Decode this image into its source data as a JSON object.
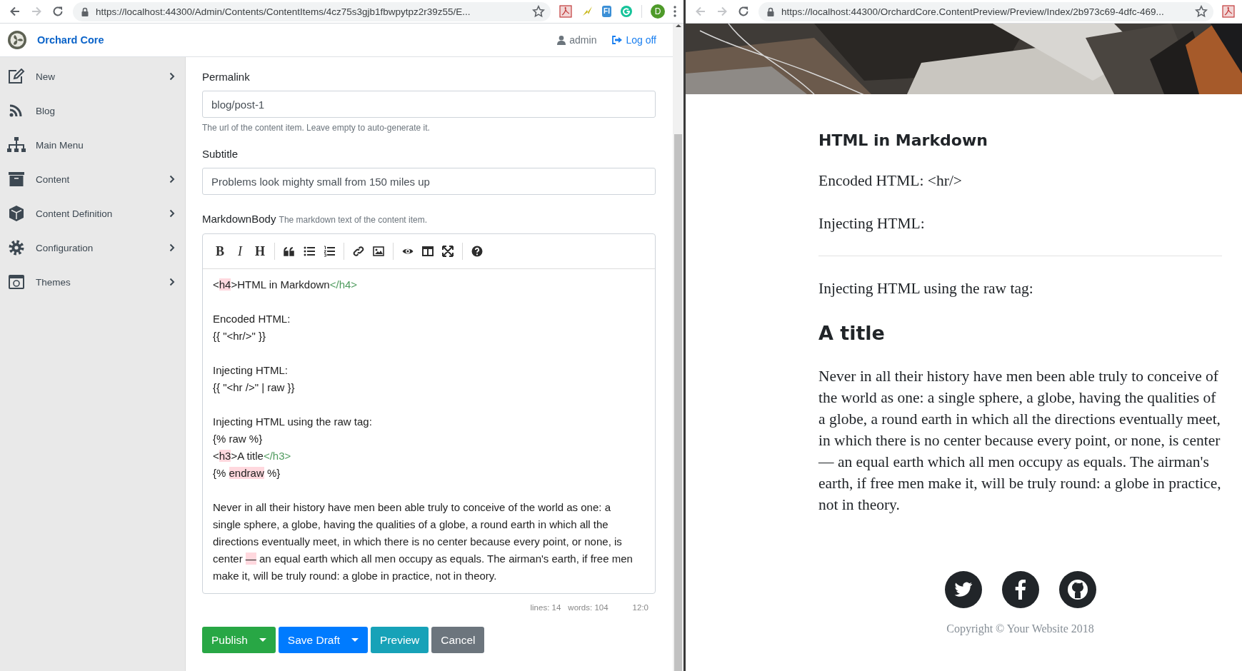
{
  "left_browser": {
    "url": "https://localhost:44300/Admin/Contents/ContentItems/4cz75s3gjb1fbwpytpz2r39z55/E...",
    "back_enabled": true,
    "forward_enabled": false,
    "extension_label": "FI",
    "profile_initial": "D"
  },
  "admin_header": {
    "brand": "Orchard Core",
    "user": "admin",
    "logoff": "Log off"
  },
  "sidebar": {
    "items": [
      {
        "label": "New",
        "has_submenu": true
      },
      {
        "label": "Blog",
        "has_submenu": false
      },
      {
        "label": "Main Menu",
        "has_submenu": false
      },
      {
        "label": "Content",
        "has_submenu": true
      },
      {
        "label": "Content Definition",
        "has_submenu": true
      },
      {
        "label": "Configuration",
        "has_submenu": true
      },
      {
        "label": "Themes",
        "has_submenu": true
      }
    ]
  },
  "form": {
    "permalink": {
      "label": "Permalink",
      "value": "blog/post-1",
      "hint": "The url of the content item. Leave empty to auto-generate it."
    },
    "subtitle": {
      "label": "Subtitle",
      "value": "Problems look mighty small from 150 miles up"
    },
    "markdown": {
      "label": "MarkdownBody",
      "hint": "The markdown text of the content item.",
      "toolbar_letters": [
        "B",
        "I",
        "H"
      ],
      "lines": [
        {
          "kind": "code",
          "segments": [
            {
              "kind": "plain",
              "text": "<"
            },
            {
              "kind": "mark",
              "text": "h4"
            },
            {
              "kind": "plain",
              "text": ">HTML in Markdown"
            },
            {
              "kind": "tag",
              "text": "</h4>"
            }
          ]
        },
        {
          "kind": "blank"
        },
        {
          "kind": "code",
          "segments": [
            {
              "kind": "plain",
              "text": "Encoded HTML:"
            }
          ]
        },
        {
          "kind": "code",
          "segments": [
            {
              "kind": "plain",
              "text": "{{ \"<hr/>\" }}"
            }
          ]
        },
        {
          "kind": "blank"
        },
        {
          "kind": "code",
          "segments": [
            {
              "kind": "plain",
              "text": "Injecting HTML:"
            }
          ]
        },
        {
          "kind": "code",
          "segments": [
            {
              "kind": "plain",
              "text": "{{ \"<hr />\" | raw }}"
            }
          ]
        },
        {
          "kind": "blank"
        },
        {
          "kind": "code",
          "segments": [
            {
              "kind": "plain",
              "text": "Injecting HTML using the raw tag:"
            }
          ]
        },
        {
          "kind": "code",
          "segments": [
            {
              "kind": "plain",
              "text": "{% raw %}"
            }
          ]
        },
        {
          "kind": "code",
          "segments": [
            {
              "kind": "plain",
              "text": "<"
            },
            {
              "kind": "mark",
              "text": "h3"
            },
            {
              "kind": "plain",
              "text": ">A title"
            },
            {
              "kind": "tag",
              "text": "</h3>"
            }
          ]
        },
        {
          "kind": "code",
          "segments": [
            {
              "kind": "plain",
              "text": "{% "
            },
            {
              "kind": "mark",
              "text": "endraw"
            },
            {
              "kind": "plain",
              "text": " %}"
            }
          ]
        },
        {
          "kind": "blank"
        },
        {
          "kind": "code",
          "segments": [
            {
              "kind": "plain",
              "text": "Never in all their history have men been able truly to conceive of the world as one: a single sphere, a globe, having the qualities of a globe, a round earth in which all the directions eventually meet, in which there is no center because every point, or none, is center "
            },
            {
              "kind": "mark",
              "text": "—"
            },
            {
              "kind": "plain",
              "text": " an equal earth which all men occupy as equals. The airman's earth, if free men make it, will be truly round: a globe in practice, not in theory."
            }
          ]
        }
      ],
      "status": {
        "lines": "lines: 14",
        "words": "words: 104",
        "cursor": "12:0"
      }
    },
    "buttons": [
      {
        "label": "Publish",
        "kind": "success",
        "split": true
      },
      {
        "label": "Save Draft",
        "kind": "primary",
        "split": true
      },
      {
        "label": "Preview",
        "kind": "info",
        "split": false
      },
      {
        "label": "Cancel",
        "kind": "secondary",
        "split": false
      }
    ]
  },
  "right_browser": {
    "url": "https://localhost:44300/OrchardCore.ContentPreview/Preview/Index/2b973c69-4dfc-469...",
    "back_enabled": false,
    "forward_enabled": false
  },
  "preview": {
    "blocks": [
      {
        "kind": "h4",
        "text": "HTML in Markdown"
      },
      {
        "kind": "p",
        "text": "Encoded HTML: <hr/>"
      },
      {
        "kind": "p",
        "text": "Injecting HTML:"
      },
      {
        "kind": "rule"
      },
      {
        "kind": "p",
        "text": "Injecting HTML using the raw tag:"
      },
      {
        "kind": "h3",
        "text": "A title"
      },
      {
        "kind": "p",
        "text": "Never in all their history have men been able truly to conceive of the world as one: a single sphere, a globe, having the qualities of a globe, a round earth in which all the directions eventually meet, in which there is no center because every point, or none, is center — an equal earth which all men occupy as equals. The airman's earth, if free men make it, will be truly round: a globe in practice, not in theory."
      }
    ],
    "copyright": "Copyright © Your Website 2018"
  }
}
